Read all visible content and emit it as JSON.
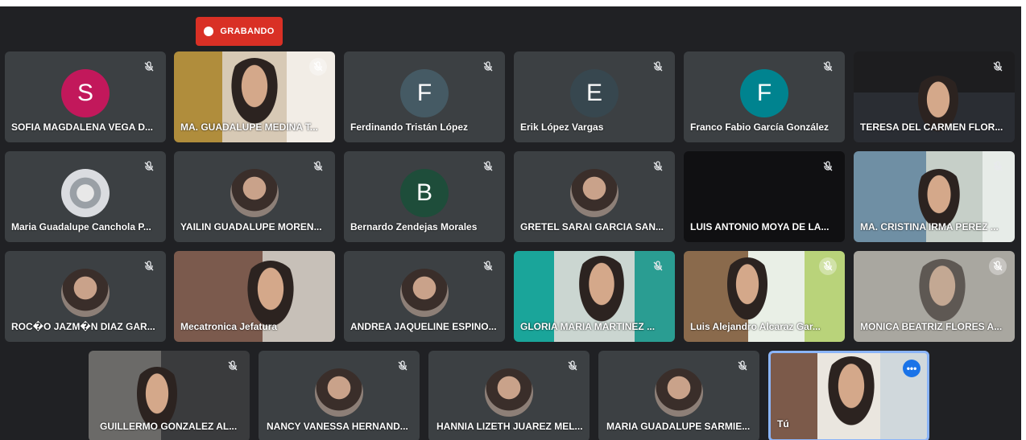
{
  "recording": {
    "label": "GRABANDO"
  },
  "colors": {
    "accent_red": "#d93025",
    "self_border": "#8ab4f8",
    "tile_bg": "#3c4043"
  },
  "participants": [
    {
      "name": "SOFIA MAGDALENA VEGA D...",
      "initial": "S",
      "avatar_color": "#c2185b",
      "mic": "muted"
    },
    {
      "name": "MA. GUADALUPE MEDINA T...",
      "initial": "",
      "mic": "muted-circle"
    },
    {
      "name": "Ferdinando Tristán López",
      "initial": "F",
      "avatar_color": "#455a64",
      "mic": "muted"
    },
    {
      "name": "Erik López Vargas",
      "initial": "E",
      "avatar_color": "#37474f",
      "mic": "muted"
    },
    {
      "name": "Franco Fabio García González",
      "initial": "F",
      "avatar_color": "#00838f",
      "mic": "muted"
    },
    {
      "name": "TERESA DEL CARMEN FLOR...",
      "initial": "",
      "mic": "muted"
    },
    {
      "name": "Maria Guadalupe Canchola P...",
      "initial": "",
      "mic": "muted"
    },
    {
      "name": "YAILIN GUADALUPE MOREN...",
      "initial": "",
      "mic": "muted"
    },
    {
      "name": "Bernardo Zendejas Morales",
      "initial": "B",
      "avatar_color": "#1e4d3a",
      "mic": "muted"
    },
    {
      "name": "GRETEL SARAI GARCIA SAN...",
      "initial": "",
      "mic": "muted"
    },
    {
      "name": "LUIS ANTONIO MOYA DE LA...",
      "initial": "",
      "mic": "muted"
    },
    {
      "name": "MA. CRISTINA IRMA PEREZ ...",
      "initial": "",
      "mic": "muted"
    },
    {
      "name": "ROC�O JAZM�N DIAZ GAR...",
      "initial": "",
      "mic": "muted"
    },
    {
      "name": "Mecatronica Jefatura",
      "initial": "",
      "mic": "none"
    },
    {
      "name": "ANDREA JAQUELINE ESPINO...",
      "initial": "",
      "mic": "muted"
    },
    {
      "name": "GLORIA MARIA MARTINEZ ...",
      "initial": "",
      "mic": "muted"
    },
    {
      "name": "Luis Alejandro Alcaraz Gar...",
      "initial": "",
      "mic": "muted-circle"
    },
    {
      "name": "MONICA BEATRIZ FLORES A...",
      "initial": "",
      "mic": "muted-circle"
    },
    {
      "name": "GUILLERMO GONZALEZ AL...",
      "initial": "",
      "mic": "muted"
    },
    {
      "name": "NANCY VANESSA HERNAND...",
      "initial": "",
      "mic": "muted"
    },
    {
      "name": "HANNIA LIZETH JUAREZ MEL...",
      "initial": "",
      "mic": "muted"
    },
    {
      "name": "MARIA GUADALUPE SARMIE...",
      "initial": "",
      "mic": "muted"
    },
    {
      "name": "Tú",
      "initial": "",
      "mic": "more"
    }
  ]
}
